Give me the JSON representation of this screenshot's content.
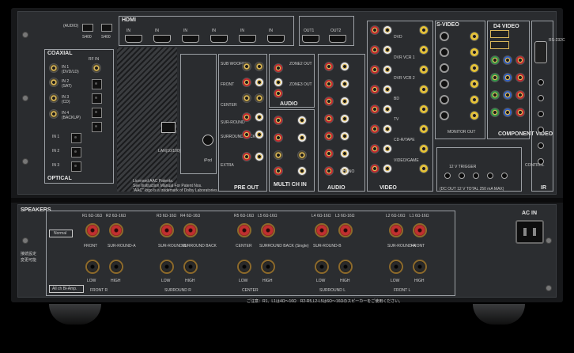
{
  "colors": {
    "chassis": "#17181a",
    "panel": "#2a2c2f",
    "red_terminal": "#c03030",
    "gold": "#d9b65a"
  },
  "upper": {
    "audio": "(AUDIO)",
    "i_link": [
      "S400",
      "S400"
    ],
    "hdmi_label": "HDMI",
    "hdmi_in": [
      "IN",
      "IN",
      "IN",
      "IN",
      "IN",
      "IN"
    ],
    "out": [
      "OUT1",
      "OUT2"
    ],
    "coaxial": "COAXIAL",
    "optical": "OPTICAL",
    "rf_in": "RF IN",
    "coax_inputs": [
      "IN 1",
      "IN 2",
      "IN 3",
      "IN 4"
    ],
    "coax_sub": [
      "(DVD/LD)",
      "(SAT)",
      "(CD)",
      "(BACKUP)"
    ],
    "opt_inputs": [
      "IN 1",
      "IN 2",
      "IN 3"
    ],
    "lan": "LAN(10/100)",
    "ipod": "iPod",
    "license": [
      "Licensed AAC Patents.",
      "See Instruction Manual For Patent Nos.",
      "\"AAC\" logo is a trademark of Dolby Laboratories."
    ],
    "preout": "PRE OUT",
    "preout_labels": [
      "SUB WOOFER",
      "FRONT",
      "CENTER",
      "SUR-ROUND",
      "SURROUND BACK",
      "EXTRA"
    ],
    "audio_sec": "AUDIO",
    "multich": "MULTI CH IN",
    "zones": [
      "ZONE2 OUT",
      "ZONE3 OUT"
    ],
    "video": "VIDEO",
    "video_inputs": [
      "DVD",
      "DVR VCR 1",
      "DVR VCR 2",
      "BD",
      "TV",
      "CD-R/TAPE",
      "VIDEO/GAME",
      "PHONO"
    ],
    "svideo": "S-VIDEO",
    "component": "COMPONENT VIDEO",
    "d4": "D4 VIDEO",
    "rs232": "RS-232C",
    "trigger": "12 V TRIGGER",
    "trigger_note": "(DC OUT 12 V TOTAL 250 mA MAX)",
    "control": "CONTROL",
    "ir": "IR",
    "monitor": "MONITOR OUT"
  },
  "lower": {
    "speakers": "SPEAKERS",
    "normal": "Normal",
    "bi_amp": "All ch Bi-Amp.",
    "setting_jp": [
      "接続設定",
      "変更可能"
    ],
    "ac_in": "AC IN",
    "groups": [
      {
        "labels": [
          "R1 6Ω-16Ω",
          "R2 6Ω-16Ω"
        ],
        "under": [
          "FRONT",
          "SUR-ROUND-A"
        ]
      },
      {
        "labels": [
          "R3 6Ω-16Ω",
          "R4 6Ω-16Ω"
        ],
        "under": [
          "SUR-ROUND-B",
          "SURROUND BACK"
        ]
      },
      {
        "labels": [
          "R5 6Ω-16Ω",
          "L5 6Ω-16Ω"
        ],
        "under": [
          "CENTER",
          "SURROUND BACK (Single)"
        ]
      },
      {
        "labels": [
          "L4 6Ω-16Ω",
          "L3 6Ω-16Ω"
        ],
        "under": [
          "SUR-ROUND-B",
          ""
        ]
      },
      {
        "labels": [
          "L2 6Ω-16Ω",
          "L1 6Ω-16Ω"
        ],
        "under": [
          "SUR-ROUND-A",
          "FRONT"
        ]
      }
    ],
    "bottom_row": [
      "LOW",
      "HIGH",
      "LOW",
      "HIGH",
      "LOW",
      "HIGH",
      "LOW",
      "HIGH",
      "LOW",
      "HIGH"
    ],
    "bottom_groups": [
      "FRONT R",
      "SURROUND R",
      "CENTER",
      "SURROUND L",
      "FRONT L"
    ],
    "note_jp": "ご注意：R1、L1は4Ω～16Ω　R2-R5,L2-L5は6Ω～16Ωのスピーカーをご使用ください。"
  }
}
